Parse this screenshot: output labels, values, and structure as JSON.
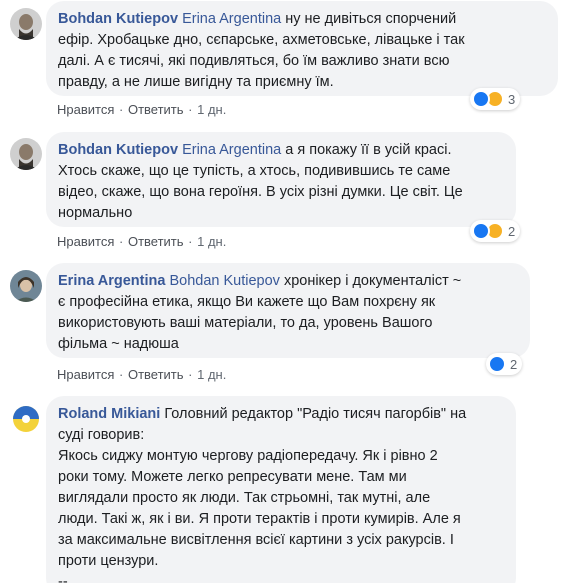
{
  "comments": [
    {
      "author": "Bohdan Kutiepov",
      "mention": "Erina Argentina",
      "lines": [
        " ну не дивіться спорчений",
        "ефір. Хробацьке дно, сєпарське, ахметовське, лівацьке і так",
        "далі. А є тисячі, які подивляться, бо їм важливо знати всю",
        "правду, а не лише вигідну та приємну їм."
      ],
      "like_label": "Нравится",
      "reply_label": "Ответить",
      "time": "1 дн.",
      "reaction_count": "3",
      "reactions": [
        "like-icon",
        "haha-icon"
      ]
    },
    {
      "author": "Bohdan Kutiepov",
      "mention": "Erina Argentina",
      "lines": [
        " а я покажу її в усій красі.",
        "Хтось скаже, що це тупість, а хтось, подивившись те саме",
        "відео, скаже, що вона героїня. В усіх різні думки. Це світ. Це",
        "нормально"
      ],
      "like_label": "Нравится",
      "reply_label": "Ответить",
      "time": "1 дн.",
      "reaction_count": "2",
      "reactions": [
        "like-icon",
        "haha-icon"
      ]
    },
    {
      "author": "Erina Argentina",
      "mention": "Bohdan Kutiepov",
      "lines": [
        " хронікер і документаліст ~",
        "є професійна етика, якщо Ви кажете що Вам похрєну як",
        "використовують ваші матеріали, то да, уровень Вашого",
        "фільма ~ надюша"
      ],
      "like_label": "Нравится",
      "reply_label": "Ответить",
      "time": "1 дн.",
      "reaction_count": "2",
      "reactions": [
        "like-icon"
      ]
    },
    {
      "author": "Roland Mikiani",
      "mention": "",
      "lines": [
        " Головний редактор \"Радіо тисяч пагорбів\" на",
        "суді говорив:",
        "Якось сиджу монтую чергову радіопередачу. Як і рівно 2",
        "роки тому. Можете легко репресувати мене. Там ми",
        "виглядали просто як люди. Так стрьомні, так мутні, але",
        "люди. Такі ж, як і ви. Я проти терактів і проти кумирів. Але я",
        "за максимальне висвітлення всієї картини з усіх ракурсів. І",
        "проти цензури.",
        "--"
      ]
    }
  ],
  "colors": {
    "link": "#385898",
    "bubble": "#f2f3f5",
    "like": "#1877f2",
    "haha": "#f7b125"
  }
}
